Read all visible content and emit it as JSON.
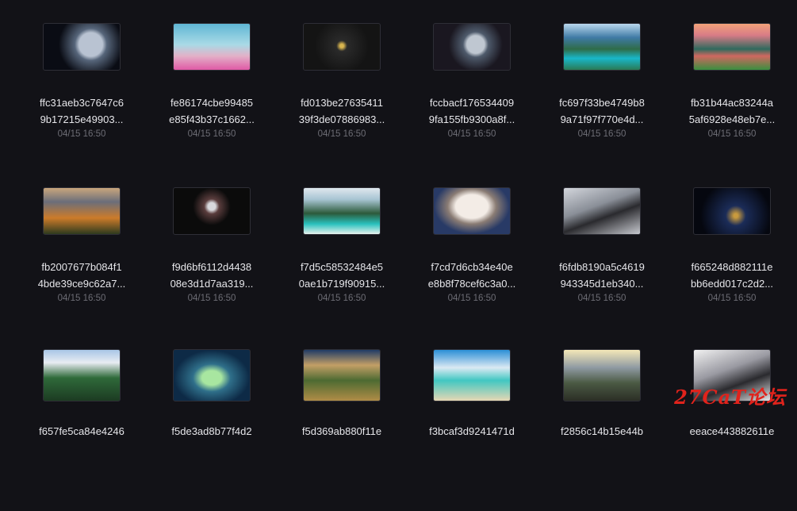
{
  "tiles": [
    {
      "name_line1": "ffc31aeb3c7647c6",
      "name_line2": "9b17215e49903...",
      "date": "04/15 16:50",
      "art": "t0",
      "icon": "earth-space-thumbnail-icon"
    },
    {
      "name_line1": "fe86174cbe99485",
      "name_line2": "e85f43b37c1662...",
      "date": "04/15 16:50",
      "art": "t1",
      "icon": "pink-field-sky-thumbnail-icon"
    },
    {
      "name_line1": "fd013be27635411",
      "name_line2": "39f3de07886983...",
      "date": "04/15 16:50",
      "art": "t2",
      "icon": "dark-logo-thumbnail-icon"
    },
    {
      "name_line1": "fccbacf176534409",
      "name_line2": "9fa155fb9300a8f...",
      "date": "04/15 16:50",
      "art": "t3",
      "icon": "planets-thumbnail-icon"
    },
    {
      "name_line1": "fc697f33be4749b8",
      "name_line2": "9a71f97f770e4d...",
      "date": "04/15 16:50",
      "art": "t4",
      "icon": "mountain-lake-thumbnail-icon"
    },
    {
      "name_line1": "fb31b44ac83244a",
      "name_line2": "5af6928e48eb7e...",
      "date": "04/15 16:50",
      "art": "t5",
      "icon": "sunset-lake-thumbnail-icon"
    },
    {
      "name_line1": "fb2007677b084f1",
      "name_line2": "4bde39ce9c62a7...",
      "date": "04/15 16:50",
      "art": "t6",
      "icon": "autumn-mountains-thumbnail-icon"
    },
    {
      "name_line1": "f9d6bf6112d4438",
      "name_line2": "08e3d1d7aa319...",
      "date": "04/15 16:50",
      "art": "t7",
      "icon": "character-dark-thumbnail-icon"
    },
    {
      "name_line1": "f7d5c58532484e5",
      "name_line2": "0ae1b719f90915...",
      "date": "04/15 16:50",
      "art": "t8",
      "icon": "coastal-cliffs-thumbnail-icon"
    },
    {
      "name_line1": "f7cd7d6cb34e40e",
      "name_line2": "e8b8f78cef6c3a0...",
      "date": "04/15 16:50",
      "art": "t9",
      "icon": "volcano-cloud-thumbnail-icon"
    },
    {
      "name_line1": "f6fdb8190a5c4619",
      "name_line2": "943345d1eb340...",
      "date": "04/15 16:50",
      "art": "t10",
      "icon": "person-stairs-thumbnail-icon"
    },
    {
      "name_line1": "f665248d882111e",
      "name_line2": "bb6edd017c2d2...",
      "date": "04/15 16:50",
      "art": "t11",
      "icon": "earth-night-thumbnail-icon"
    },
    {
      "name_line1": "f657fe5ca84e4246",
      "name_line2": "",
      "date": "",
      "art": "t12",
      "icon": "alpine-valley-thumbnail-icon"
    },
    {
      "name_line1": "f5de3ad8b77f4d2",
      "name_line2": "",
      "date": "",
      "art": "t13",
      "icon": "island-aerial-thumbnail-icon"
    },
    {
      "name_line1": "f5d369ab880f11e",
      "name_line2": "",
      "date": "",
      "art": "t14",
      "icon": "meadow-hills-thumbnail-icon"
    },
    {
      "name_line1": "f3bcaf3d9241471d",
      "name_line2": "",
      "date": "",
      "art": "t15",
      "icon": "beach-sky-thumbnail-icon"
    },
    {
      "name_line1": "f2856c14b15e44b",
      "name_line2": "",
      "date": "",
      "art": "t16",
      "icon": "mountain-sunburst-thumbnail-icon"
    },
    {
      "name_line1": "eeace443882611e",
      "name_line2": "",
      "date": "",
      "art": "t17",
      "icon": "character-white-thumbnail-icon"
    }
  ],
  "watermark": "27CaT论坛"
}
